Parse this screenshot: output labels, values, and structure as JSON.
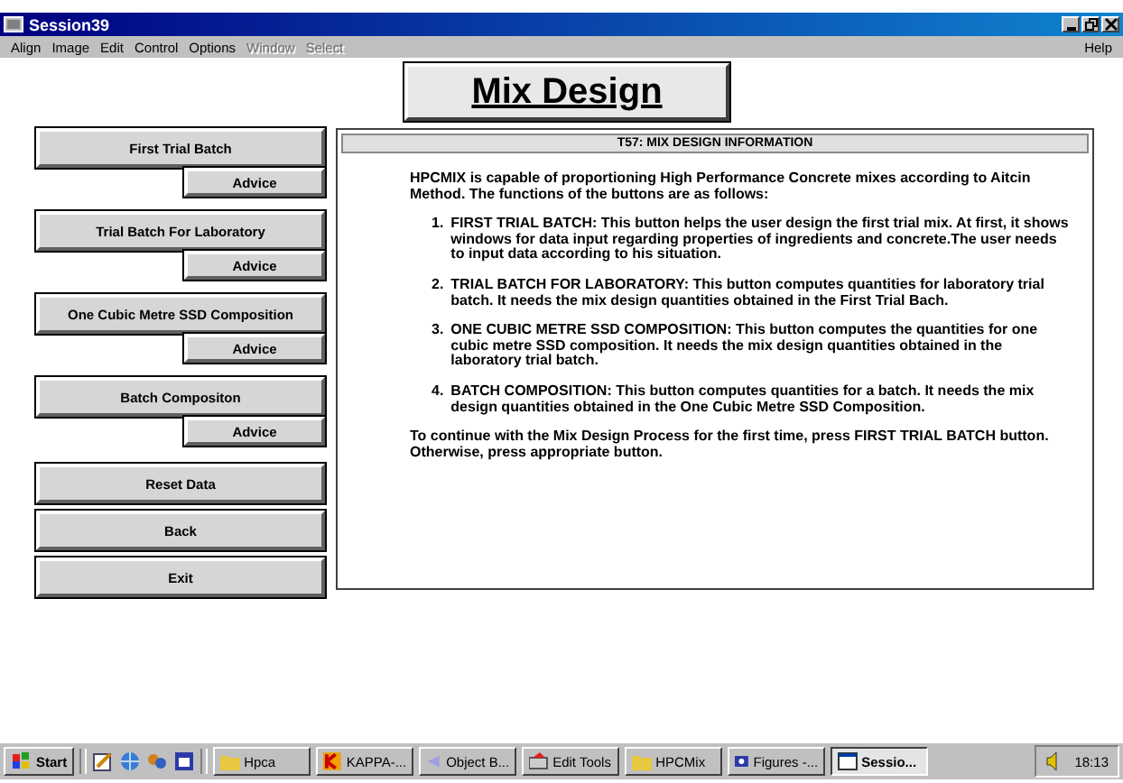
{
  "window": {
    "title": "Session39"
  },
  "menu": [
    {
      "label": "Align",
      "disabled": false
    },
    {
      "label": "Image",
      "disabled": false
    },
    {
      "label": "Edit",
      "disabled": false
    },
    {
      "label": "Control",
      "disabled": false
    },
    {
      "label": "Options",
      "disabled": false
    },
    {
      "label": "Window",
      "disabled": true
    },
    {
      "label": "Select",
      "disabled": true
    }
  ],
  "help_menu": "Help",
  "heading": "Mix Design",
  "actions": [
    {
      "label": "First Trial Batch",
      "advice": "Advice"
    },
    {
      "label": "Trial Batch For Laboratory",
      "advice": "Advice"
    },
    {
      "label": "One Cubic Metre SSD Composition",
      "advice": "Advice"
    },
    {
      "label": "Batch Compositon",
      "advice": "Advice"
    }
  ],
  "buttons": [
    "Reset Data",
    "Back",
    "Exit"
  ],
  "info": {
    "title": "T57: MIX DESIGN INFORMATION",
    "intro": "HPCMIX is capable of proportioning High Performance Concrete mixes according to Aitcin Method. The functions of the buttons are as follows:",
    "items": [
      {
        "number": "1.",
        "text": "FIRST TRIAL BATCH: This button helps the user design the first trial mix. At first, it shows windows for data input regarding properties of ingredients and concrete.The user needs to input data according to his situation."
      },
      {
        "number": "2.",
        "text": "TRIAL BATCH FOR LABORATORY: This button computes quantities for laboratory trial batch. It needs the mix design quantities obtained in the First Trial Bach."
      },
      {
        "number": "3.",
        "text": "ONE CUBIC METRE SSD COMPOSITION: This button computes the quantities for one cubic metre SSD composition. It needs the mix design quantities obtained in the laboratory trial batch."
      },
      {
        "number": "4.",
        "text": "BATCH COMPOSITION: This button computes quantities for a batch. It needs the mix design quantities obtained in the One Cubic Metre SSD Composition."
      }
    ],
    "outro": "To continue with the Mix Design Process for the first time, press FIRST TRIAL BATCH button. Otherwise, press appropriate button."
  },
  "taskbar": {
    "start": "Start",
    "tasks": [
      {
        "label": "Hpca",
        "kind": "folder",
        "selected": false
      },
      {
        "label": "KAPPA-...",
        "kind": "kappa",
        "selected": false
      },
      {
        "label": "Object B...",
        "kind": "object",
        "selected": false
      },
      {
        "label": "Edit Tools",
        "kind": "tools",
        "selected": false
      },
      {
        "label": "HPCMix",
        "kind": "folder",
        "selected": false
      },
      {
        "label": "Figures -...",
        "kind": "figures",
        "selected": false
      },
      {
        "label": "Sessio...",
        "kind": "window",
        "selected": true
      }
    ],
    "clock": "18:13"
  }
}
